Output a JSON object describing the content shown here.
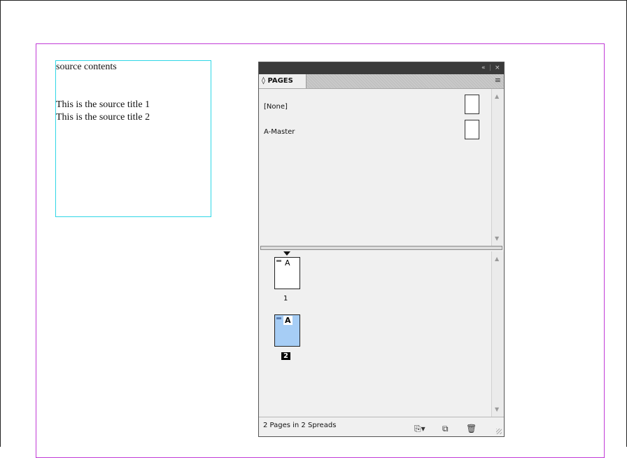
{
  "text_frame": {
    "lines": [
      "source contents",
      "This is the source title 1",
      "This is the source title 2"
    ]
  },
  "pages_panel": {
    "tab_label": "PAGES",
    "tab_icon": "◊",
    "collapse_icon": "«",
    "close_icon": "×",
    "menu_icon": "≡",
    "masters": [
      {
        "label": "[None]"
      },
      {
        "label": "A-Master"
      }
    ],
    "pages": [
      {
        "number": "1",
        "master": "A",
        "selected": false
      },
      {
        "number": "2",
        "master": "A",
        "selected": true
      }
    ],
    "status": "2 Pages in 2 Spreads",
    "selected_color": "#a6cdf5",
    "accent_margin": "#c13ad6",
    "frame_color": "#2fd7e6"
  }
}
